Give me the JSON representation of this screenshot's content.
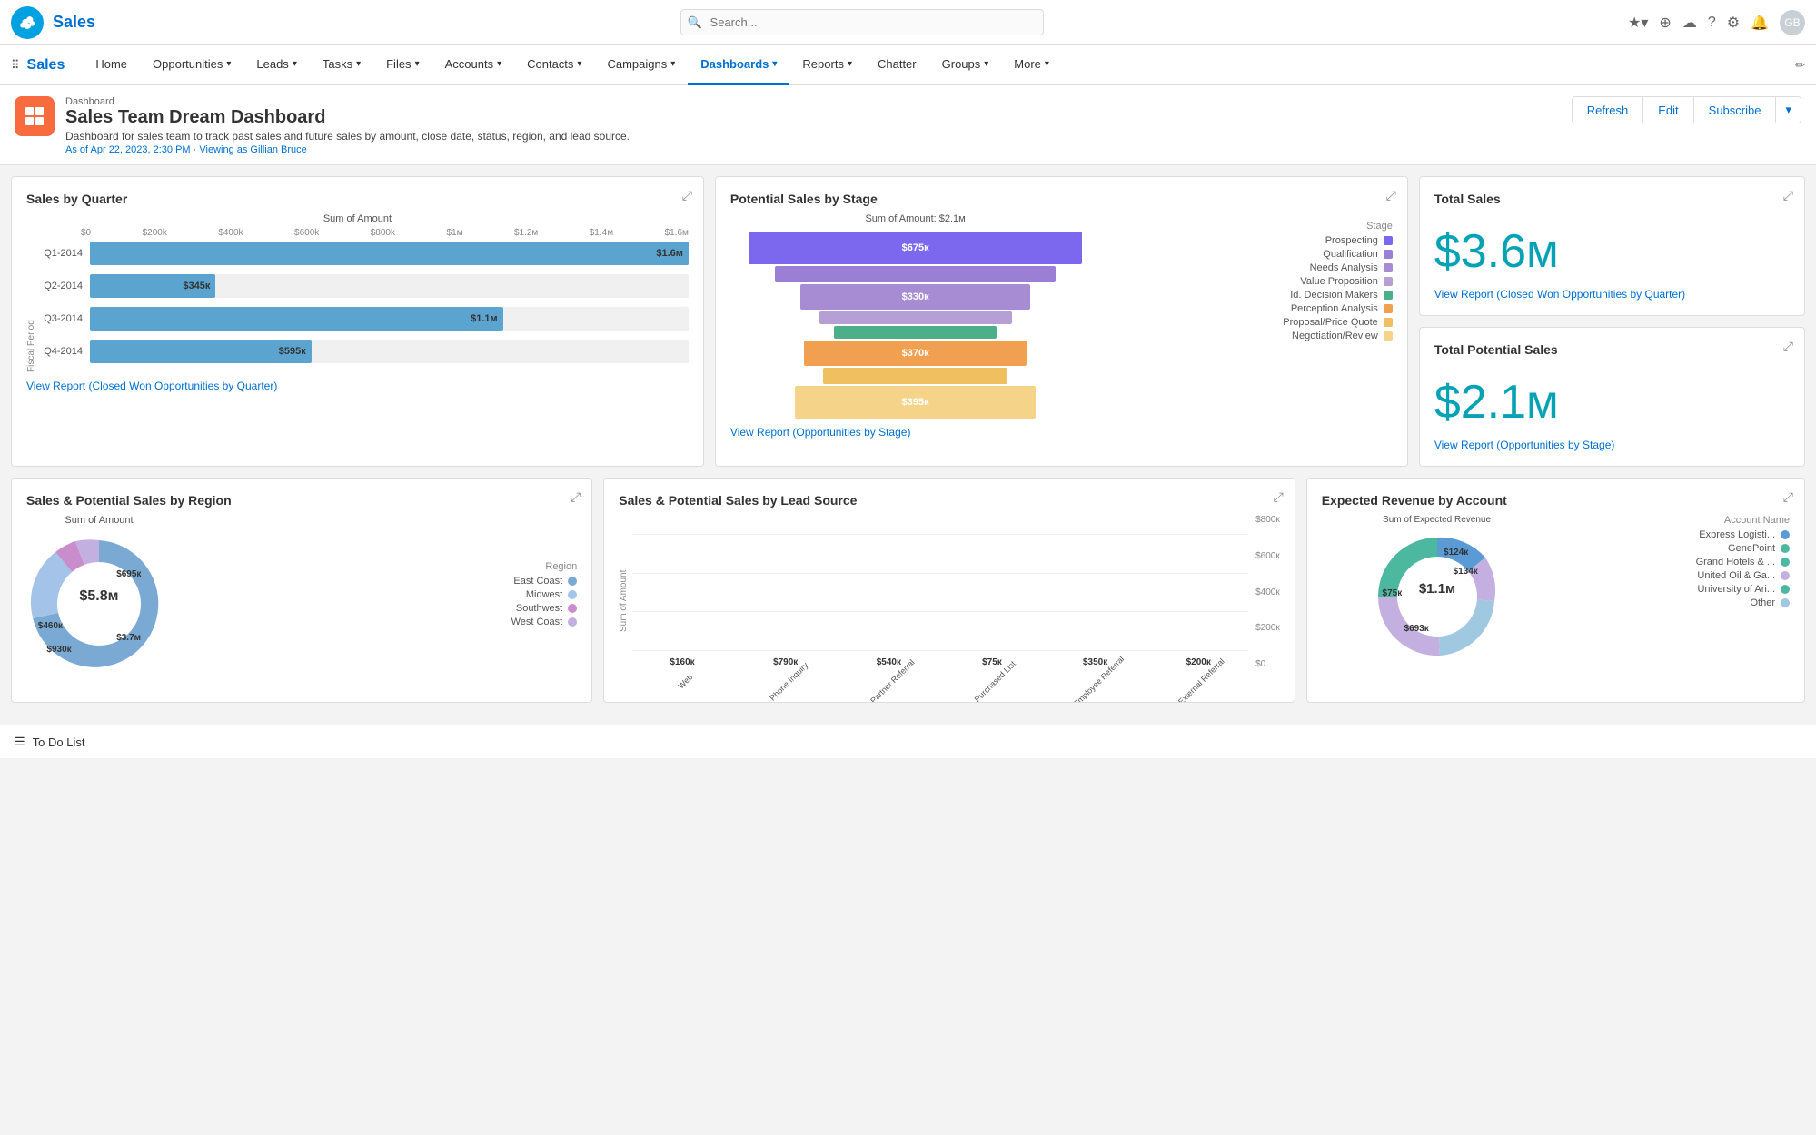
{
  "app": {
    "name": "Sales",
    "logo_alt": "Salesforce"
  },
  "search": {
    "placeholder": "Search..."
  },
  "topnav": {
    "icons": [
      "star",
      "add",
      "cloud",
      "help",
      "settings",
      "bell",
      "avatar"
    ]
  },
  "secnav": {
    "items": [
      {
        "label": "Home",
        "has_chevron": false,
        "active": false
      },
      {
        "label": "Opportunities",
        "has_chevron": true,
        "active": false
      },
      {
        "label": "Leads",
        "has_chevron": true,
        "active": false
      },
      {
        "label": "Tasks",
        "has_chevron": true,
        "active": false
      },
      {
        "label": "Files",
        "has_chevron": true,
        "active": false
      },
      {
        "label": "Accounts",
        "has_chevron": true,
        "active": false
      },
      {
        "label": "Contacts",
        "has_chevron": true,
        "active": false
      },
      {
        "label": "Campaigns",
        "has_chevron": true,
        "active": false
      },
      {
        "label": "Dashboards",
        "has_chevron": true,
        "active": true
      },
      {
        "label": "Reports",
        "has_chevron": true,
        "active": false
      },
      {
        "label": "Chatter",
        "has_chevron": false,
        "active": false
      },
      {
        "label": "Groups",
        "has_chevron": true,
        "active": false
      },
      {
        "label": "More",
        "has_chevron": true,
        "active": false
      }
    ]
  },
  "dashboard": {
    "label": "Dashboard",
    "title": "Sales Team Dream Dashboard",
    "description": "Dashboard for sales team to track past sales and future sales by amount, close date, status, region, and lead source.",
    "meta": "As of Apr 22, 2023, 2:30 PM · Viewing as Gillian Bruce",
    "actions": {
      "refresh": "Refresh",
      "edit": "Edit",
      "subscribe": "Subscribe"
    }
  },
  "sales_by_quarter": {
    "title": "Sales by Quarter",
    "chart_title": "Sum of Amount",
    "axis_label": "Fiscal Period",
    "x_labels": [
      "$0",
      "$200k",
      "$400k",
      "$600k",
      "$800k",
      "$1м",
      "$1.2м",
      "$1.4м",
      "$1.6м"
    ],
    "bars": [
      {
        "label": "Q1-2014",
        "value": "$1.6м",
        "pct": 100
      },
      {
        "label": "Q2-2014",
        "value": "$345к",
        "pct": 21
      },
      {
        "label": "Q3-2014",
        "value": "$1.1м",
        "pct": 69
      },
      {
        "label": "Q4-2014",
        "value": "$595к",
        "pct": 37
      }
    ],
    "link": "View Report (Closed Won Opportunities by Quarter)"
  },
  "potential_by_stage": {
    "title": "Potential Sales by Stage",
    "subtitle": "Sum of Amount: $2.1м",
    "legend_title": "Stage",
    "segments": [
      {
        "label": "Prospecting",
        "value": "$675к",
        "color": "#7b68ee",
        "width_pct": 90
      },
      {
        "label": "Qualification",
        "value": "",
        "color": "#9b7fd4",
        "width_pct": 70
      },
      {
        "label": "Needs Analysis",
        "value": "$330к",
        "color": "#a78cd4",
        "width_pct": 55
      },
      {
        "label": "Value Proposition",
        "value": "",
        "color": "#b59fd4",
        "width_pct": 45
      },
      {
        "label": "Id. Decision Makers",
        "value": "",
        "color": "#4caf8a",
        "width_pct": 38
      },
      {
        "label": "Perception Analysis",
        "value": "$370к",
        "color": "#f0a050",
        "width_pct": 55
      },
      {
        "label": "Proposal/Price Quote",
        "value": "",
        "color": "#f0c060",
        "width_pct": 42
      },
      {
        "label": "Negotiation/Review",
        "value": "$395к",
        "color": "#f5d48a",
        "width_pct": 58
      }
    ],
    "link": "View Report (Opportunities by Stage)"
  },
  "total_sales": {
    "title": "Total Sales",
    "value": "$3.6м",
    "link": "View Report (Closed Won Opportunities by Quarter)"
  },
  "total_potential_sales": {
    "title": "Total Potential Sales",
    "value": "$2.1м",
    "link": "View Report (Opportunities by Stage)"
  },
  "sales_by_region": {
    "title": "Sales & Potential Sales by Region",
    "chart_label": "Sum of Amount",
    "center_value": "$5.8м",
    "legend_title": "Region",
    "segments": [
      {
        "label": "East Coast",
        "value": "$3.7м",
        "color": "#7aaad4",
        "pct": 63
      },
      {
        "label": "Midwest",
        "value": "$930к",
        "color": "#a3c4e8",
        "pct": 16
      },
      {
        "label": "Southwest",
        "value": "$460к",
        "color": "#c98dcc",
        "pct": 8
      },
      {
        "label": "West Coast",
        "value": "$695к",
        "color": "#c4b0e0",
        "pct": 12
      }
    ]
  },
  "sales_by_lead": {
    "title": "Sales & Potential Sales by Lead Source",
    "y_labels": [
      "$800к",
      "$600к",
      "$400к",
      "$200к",
      "$0"
    ],
    "bars": [
      {
        "label": "Web",
        "value": "$160к",
        "height_pct": 20
      },
      {
        "label": "Phone Inquiry",
        "value": "$790к",
        "height_pct": 99
      },
      {
        "label": "Partner Referral",
        "value": "$540к",
        "height_pct": 68
      },
      {
        "label": "Purchased List",
        "value": "$75к",
        "height_pct": 9
      },
      {
        "label": "Employee Referral",
        "value": "$350к",
        "height_pct": 44
      },
      {
        "label": "External Referral",
        "value": "$200к",
        "height_pct": 25
      }
    ],
    "y_axis_label": "Sum of Amount"
  },
  "expected_revenue": {
    "title": "Expected Revenue by Account",
    "chart_label": "Sum of Expected Revenue",
    "center_value": "$1.1м",
    "legend_title": "Account Name",
    "segments": [
      {
        "label": "Express Logisti...",
        "value": "$124к",
        "color": "#5b9bd5"
      },
      {
        "label": "GenePoint",
        "value": "",
        "color": "#70b8d4"
      },
      {
        "label": "Grand Hotels & ...",
        "value": "",
        "color": "#4db8a0"
      },
      {
        "label": "United Oil & Ga...",
        "value": "$134к",
        "color": "#c4b0e0"
      },
      {
        "label": "University of Ari...",
        "value": "",
        "color": "#4db8a0"
      },
      {
        "label": "Other",
        "value": "$693к",
        "color": "#a0d4b0"
      }
    ],
    "donut_values": [
      {
        "label": "$75к",
        "color": "#4db8a0"
      },
      {
        "label": "$124к",
        "color": "#5b9bd5"
      },
      {
        "label": "$134к",
        "color": "#c4b0e0"
      },
      {
        "label": "$693к",
        "color": "#a0c8e0"
      }
    ]
  },
  "footer": {
    "label": "To Do List"
  }
}
